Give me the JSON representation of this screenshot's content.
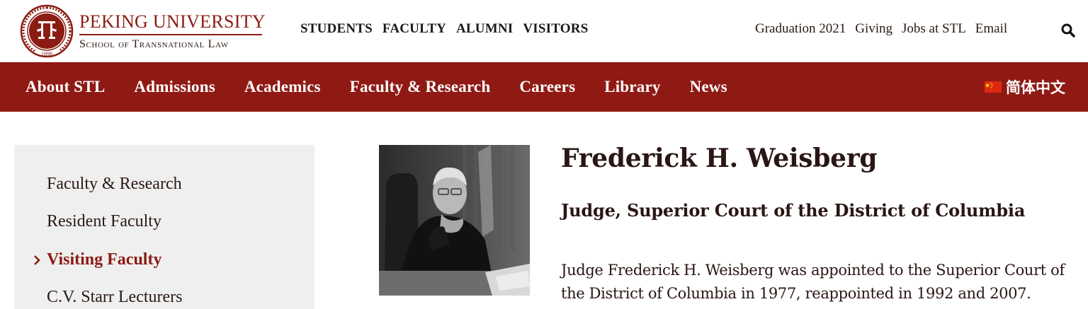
{
  "header": {
    "university": "PEKING UNIVERSITY",
    "school": "School of Transnational Law",
    "seal_year": "1898",
    "primary_nav": [
      "STUDENTS",
      "FACULTY",
      "ALUMNI",
      "VISITORS"
    ],
    "utility_nav": [
      "Graduation 2021",
      "Giving",
      "Jobs at STL",
      "Email"
    ],
    "search_icon": "search-icon"
  },
  "main_nav": {
    "items": [
      "About STL",
      "Admissions",
      "Academics",
      "Faculty & Research",
      "Careers",
      "Library",
      "News"
    ],
    "language": "简体中文",
    "flag_icon": "china-flag-icon"
  },
  "sidebar": {
    "items": [
      {
        "label": "Faculty & Research",
        "active": false
      },
      {
        "label": "Resident Faculty",
        "active": false
      },
      {
        "label": "Visiting Faculty",
        "active": true
      },
      {
        "label": "C.V. Starr Lecturers",
        "active": false
      }
    ]
  },
  "profile": {
    "name": "Frederick H. Weisberg",
    "title": "Judge, Superior Court of the District of Columbia",
    "bio": "Judge Frederick H. Weisberg was appointed to the Superior Court of the District of Columbia in 1977, reappointed in 1992 and 2007."
  },
  "colors": {
    "brand_red": "#8f1a14",
    "sidebar_bg": "#efefef",
    "text_dark": "#2a1614"
  }
}
